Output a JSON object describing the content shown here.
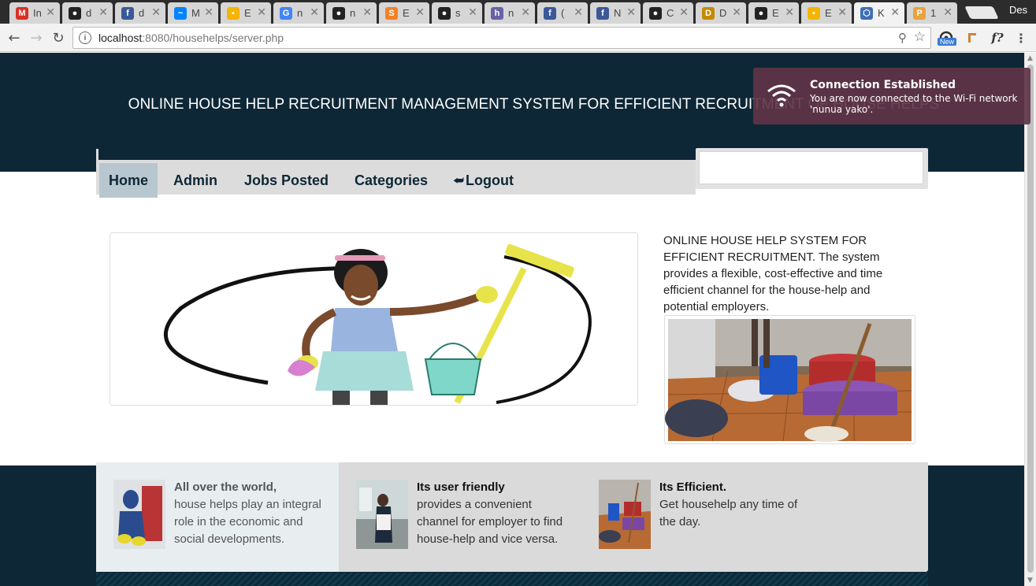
{
  "browser": {
    "tabs": [
      {
        "icon": "gmail-icon",
        "label": "In",
        "color": "#d93025",
        "glyph": "M"
      },
      {
        "icon": "github-icon",
        "label": "d",
        "color": "#222222",
        "glyph": "●"
      },
      {
        "icon": "facebook-icon",
        "label": "d",
        "color": "#3b5998",
        "glyph": "f"
      },
      {
        "icon": "messenger-icon",
        "label": "M",
        "color": "#0084ff",
        "glyph": "~"
      },
      {
        "icon": "slides-icon",
        "label": "E",
        "color": "#f4b400",
        "glyph": "▪"
      },
      {
        "icon": "google-icon",
        "label": "n",
        "color": "#4285f4",
        "glyph": "G"
      },
      {
        "icon": "github-icon",
        "label": "n",
        "color": "#222222",
        "glyph": "●"
      },
      {
        "icon": "stackoverflow-icon",
        "label": "E",
        "color": "#f48024",
        "glyph": "S"
      },
      {
        "icon": "github-icon",
        "label": "s",
        "color": "#222222",
        "glyph": "●"
      },
      {
        "icon": "heroku-icon",
        "label": "n",
        "color": "#6762a6",
        "glyph": "h"
      },
      {
        "icon": "facebook-icon",
        "label": "(",
        "color": "#3b5998",
        "glyph": "f"
      },
      {
        "icon": "facebook-icon",
        "label": "N",
        "color": "#3b5998",
        "glyph": "f"
      },
      {
        "icon": "github-icon",
        "label": "C",
        "color": "#222222",
        "glyph": "●"
      },
      {
        "icon": "dev-icon",
        "label": "D",
        "color": "#c58a00",
        "glyph": "D"
      },
      {
        "icon": "github-icon",
        "label": "E",
        "color": "#222222",
        "glyph": "●"
      },
      {
        "icon": "slides-icon",
        "label": "E",
        "color": "#f4b400",
        "glyph": "▪"
      },
      {
        "icon": "hexagon-icon",
        "label": "K",
        "color": "#3d6fb6",
        "glyph": "⬡",
        "active": true
      },
      {
        "icon": "phpmyadmin-icon",
        "label": "1",
        "color": "#e8a33d",
        "glyph": "P"
      }
    ],
    "tab_close_glyph": "✕",
    "user_label": "Des",
    "url_host": "localhost",
    "url_path": ":8080/househelps/server.php",
    "info_glyph": "i",
    "extension_new_badge": "New",
    "extension_f_label": "f?"
  },
  "site": {
    "title": "ONLINE HOUSE HELP RECRUITMENT MANAGEMENT SYSTEM FOR EFFICIENT RECRUITMENT OF HOUSE HELPS",
    "nav": [
      {
        "label": "Home",
        "active": true
      },
      {
        "label": "Admin"
      },
      {
        "label": "Jobs Posted"
      },
      {
        "label": "Categories"
      },
      {
        "label": "Logout"
      }
    ],
    "logout_glyph": "⮨",
    "search_value": "",
    "intro": "ONLINE HOUSE HELP SYSTEM FOR EFFICIENT RECRUITMENT. The system provides a flexible, cost-effective and time efficient channel for the house-help and potential employers.",
    "features": [
      {
        "title": "All over the world,",
        "text": "house helps play an integral role in the economic and social developments."
      },
      {
        "title": "Its user friendly",
        "text": "provides a convenient channel for employer to find house-help and vice versa."
      },
      {
        "title": "Its Efficient.",
        "text": "Get househelp any time of the day."
      }
    ]
  },
  "notification": {
    "title": "Connection Established",
    "body": "You are now connected to the Wi-Fi network 'nunua yako'."
  },
  "colors": {
    "header_bg": "#0e2736",
    "nav_bg": "#dcdcdc",
    "nav_active": "#b8c7cf",
    "nav_text": "#0e2736",
    "notification_bg": "#603446"
  }
}
